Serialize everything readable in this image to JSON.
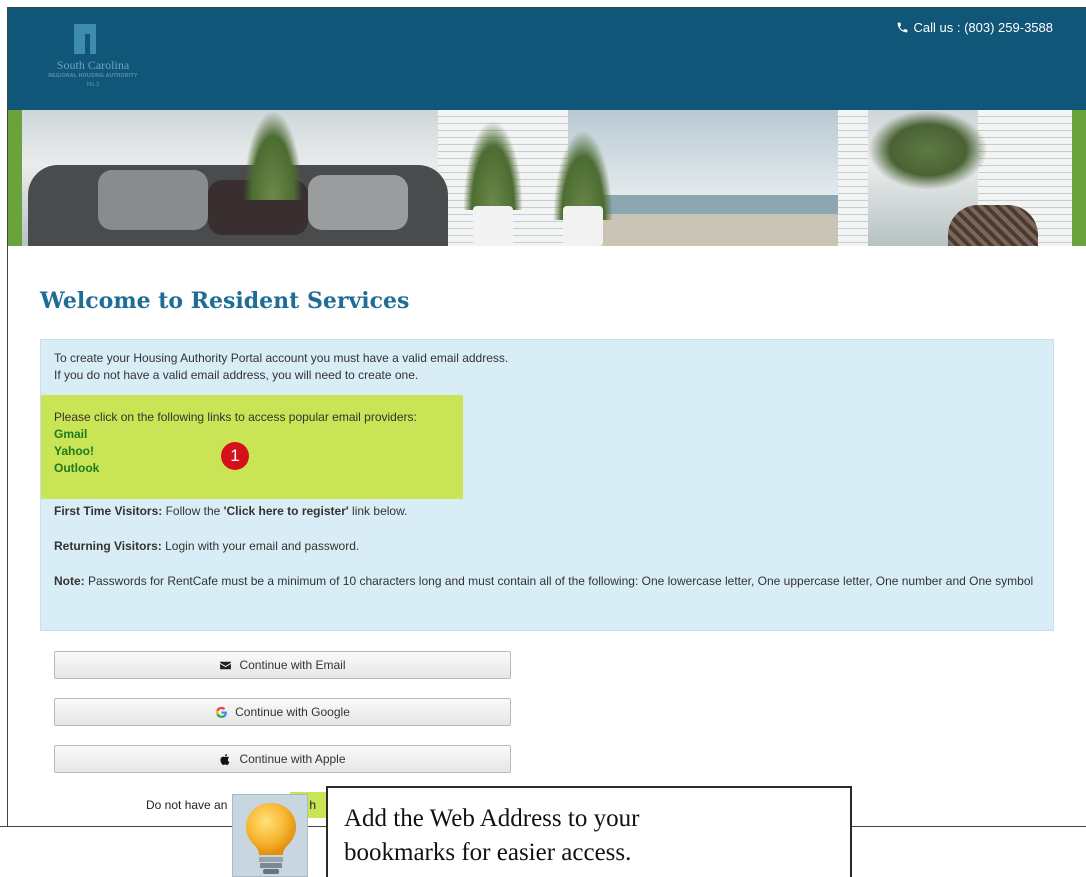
{
  "header": {
    "logo": {
      "line1": "South Carolina",
      "line2": "REGIONAL HOUSING AUTHORITY",
      "line3": "No.3"
    },
    "phone_text": "Call us : (803) 259-3588"
  },
  "page": {
    "title": "Welcome to Resident Services"
  },
  "info": {
    "intro_line1": "To create your Housing Authority Portal account you must have a valid email address.",
    "intro_line2": "If you do not have a valid email address, you will need to create one.",
    "providers_label": "Please click on the following links to access popular email providers:",
    "providers": [
      "Gmail",
      "Yahoo!",
      "Outlook"
    ],
    "first_visitors_label": "First Time Visitors:",
    "first_visitors_pre": " Follow the ",
    "first_visitors_link": "'Click here to register'",
    "first_visitors_post": " link below.",
    "returning_label": "Returning Visitors:",
    "returning_text": " Login with your email and password.",
    "note_label": "Note:",
    "note_text": " Passwords for RentCafe must be a minimum of 10 characters long and must contain all of the following: One lowercase letter, One uppercase letter, One number and One symbol"
  },
  "annotations": {
    "badge1": "1"
  },
  "buttons": {
    "email": "Continue with Email",
    "google": "Continue with Google",
    "apple": "Continue with Apple"
  },
  "register": {
    "prefix": "Do not have an",
    "link_partial": "ck h"
  },
  "tip": {
    "line1": "Add the Web Address to your",
    "line2": "bookmarks for easier access."
  },
  "colors": {
    "header_bg": "#0f5679",
    "title": "#1f6d96",
    "info_bg": "#d9edf6",
    "highlight": "#c9e455",
    "link_green": "#1e7a1e",
    "badge_red": "#d4101a"
  }
}
